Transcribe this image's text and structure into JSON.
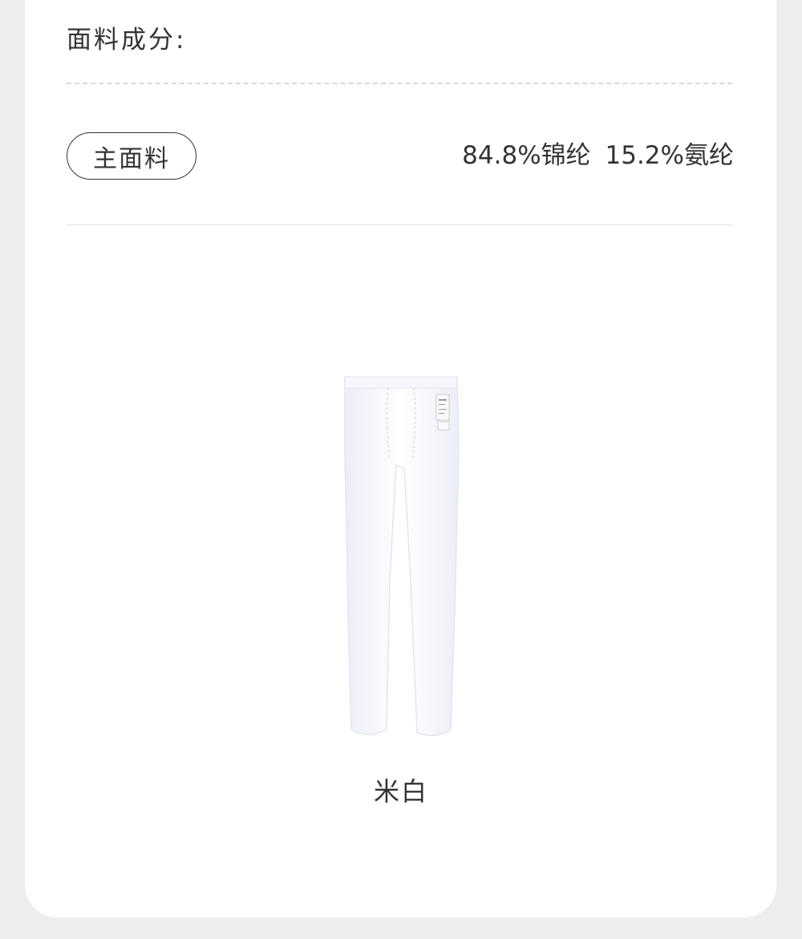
{
  "fabric": {
    "title": "面料成分:",
    "main_label": "主面料",
    "composition": "84.8%锦纶  15.2%氨纶"
  },
  "product": {
    "image_icon": "white-tights-image",
    "color_name": "米白"
  },
  "colors": {
    "background": "#eeeeee",
    "card": "#ffffff",
    "text": "#333333"
  }
}
